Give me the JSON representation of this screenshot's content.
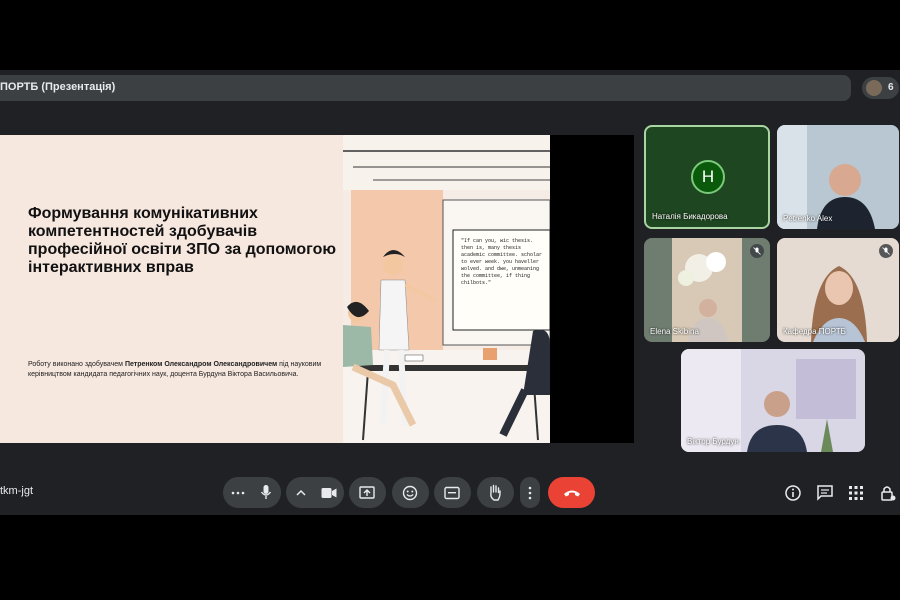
{
  "window_title": "ПОРТБ (Презентація)",
  "participant_count": "6",
  "slide": {
    "title": "Формування комунікативних компетентностей здобувачів професійної освіти ЗПО за допомогою інтерактивних вправ",
    "author_prefix": "Роботу виконано здобувачем ",
    "author_name": "Петренком Олександром Олександровичем",
    "supervisor": " під науковим керівництвом кандидата педагогічних наук, доцента Бурдуна Віктора Васильовича.",
    "board_text": "\"If can you, wic thesis. then is, many thesis academic committee. scholar to ever week. you haveller wolved. and dwe, unmeaning the committee, if thing chilbots.\""
  },
  "tiles": [
    {
      "name": "Наталія Бикадорова",
      "avatar_letter": "Н"
    },
    {
      "name": "Petrenko Alex"
    },
    {
      "name": "Elena Skibina"
    },
    {
      "name": "Кафедра ПОРТБ"
    },
    {
      "name": "Віктор Бурдун"
    }
  ],
  "meeting_code": "tkm-jgt",
  "colors": {
    "end_call": "#ea4335",
    "active_speaker_border": "#a8d5a2",
    "avatar_bg": "#1e4620"
  }
}
